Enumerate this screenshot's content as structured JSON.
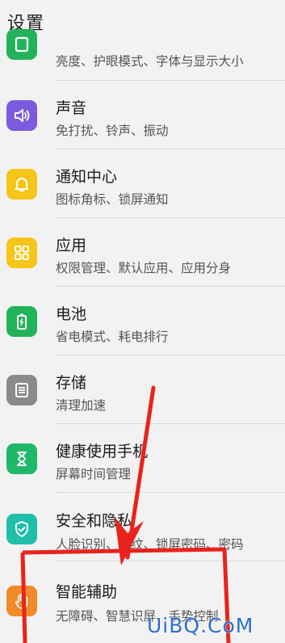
{
  "header": {
    "title": "设置"
  },
  "items": [
    {
      "title": "",
      "subtitle": "亮度、护眼模式、字体与显示大小",
      "icon": "display-icon",
      "color": "#22b35a"
    },
    {
      "title": "声音",
      "subtitle": "免打扰、铃声、振动",
      "icon": "speaker-icon",
      "color": "#7b5ae0"
    },
    {
      "title": "通知中心",
      "subtitle": "图标角标、锁屏通知",
      "icon": "bell-icon",
      "color": "#f5c518"
    },
    {
      "title": "应用",
      "subtitle": "权限管理、默认应用、应用分身",
      "icon": "apps-grid-icon",
      "color": "#f5c518"
    },
    {
      "title": "电池",
      "subtitle": "省电模式、耗电排行",
      "icon": "battery-icon",
      "color": "#22b35a"
    },
    {
      "title": "存储",
      "subtitle": "清理加速",
      "icon": "storage-icon",
      "color": "#8a8a8a"
    },
    {
      "title": "健康使用手机",
      "subtitle": "屏幕时间管理",
      "icon": "hourglass-icon",
      "color": "#1fb86a"
    },
    {
      "title": "安全和隐私",
      "subtitle": "人脸识别、指纹、锁屏密码、密码",
      "icon": "shield-icon",
      "color": "#1fbfa9"
    },
    {
      "title": "智能辅助",
      "subtitle": "无障碍、智慧识屏、手势控制",
      "icon": "hand-icon",
      "color": "#f08a2a"
    }
  ],
  "annotation": {
    "highlight_color": "#e8231c"
  },
  "watermark": {
    "text": "UiBQ.CoM"
  }
}
